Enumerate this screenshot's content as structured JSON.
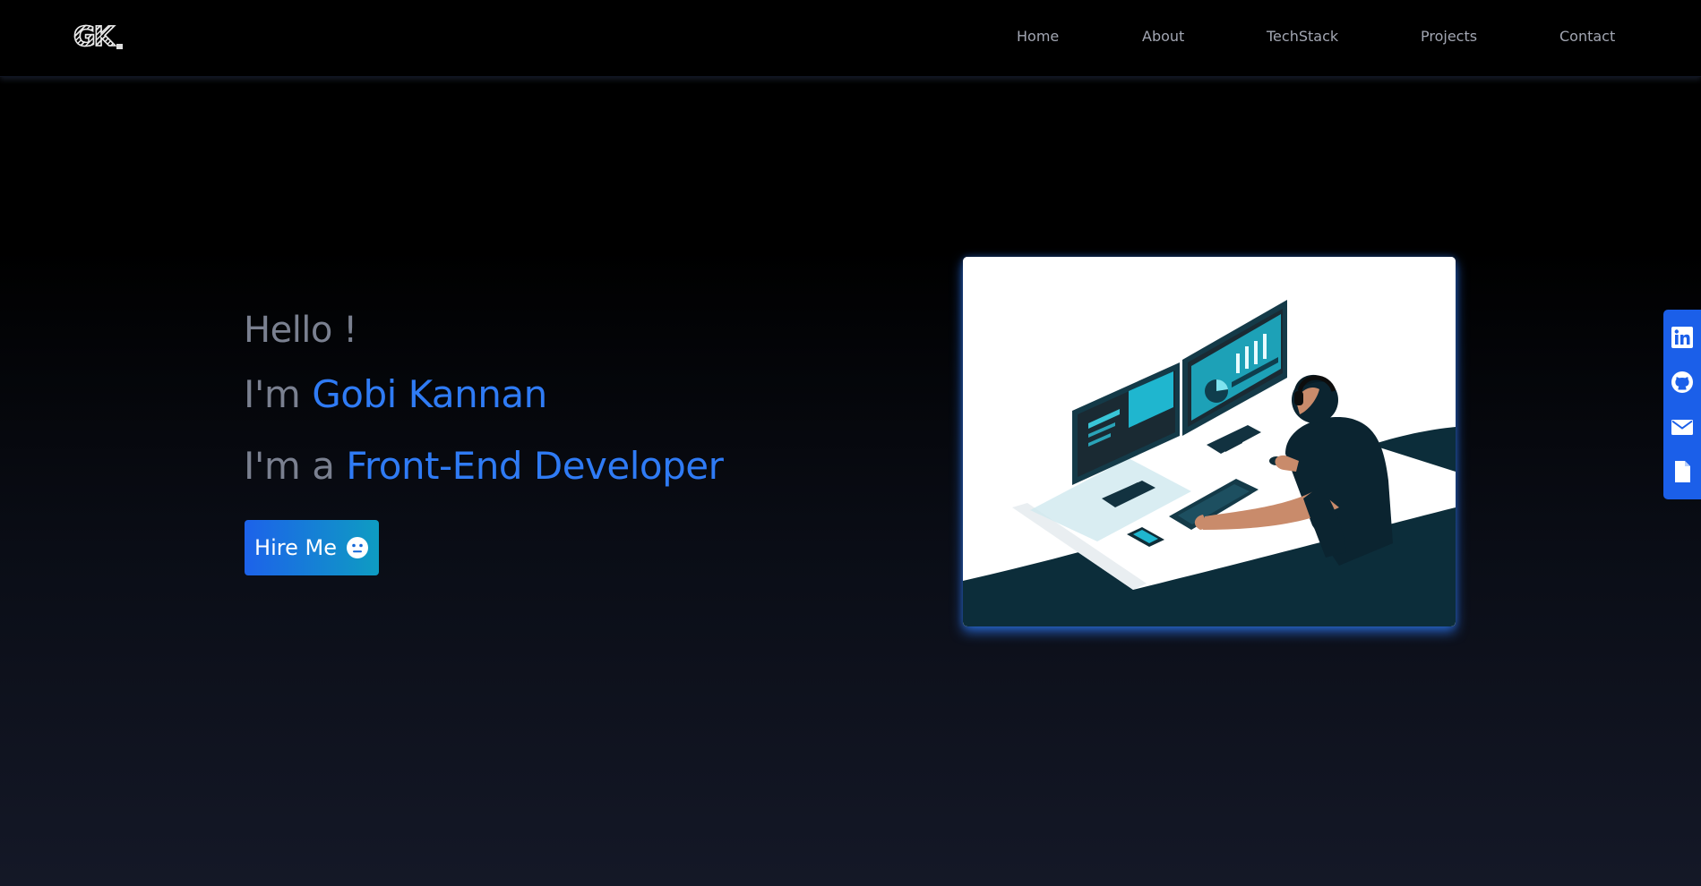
{
  "nav": {
    "logo": "GK",
    "links": [
      "Home",
      "About",
      "TechStack",
      "Projects",
      "Contact"
    ]
  },
  "hero": {
    "greeting": "Hello !",
    "name_prefix": "I'm ",
    "name": "Gobi Kannan",
    "role_prefix": "I'm a ",
    "role": "Front-End Developer",
    "cta_label": "Hire Me",
    "cta_icon": "neutral-face-icon",
    "illustration": "developer-at-dual-monitor-workstation"
  },
  "social": {
    "icons": [
      "linkedin-icon",
      "github-icon",
      "email-icon",
      "resume-document-icon"
    ]
  },
  "colors": {
    "accent": "#2f7bf5",
    "muted_text": "#7a8090",
    "nav_text": "#a2a6b2",
    "social_bar": "#1b5fe9",
    "button_gradient_start": "#1d62ea",
    "button_gradient_end": "#0e9cc2"
  }
}
